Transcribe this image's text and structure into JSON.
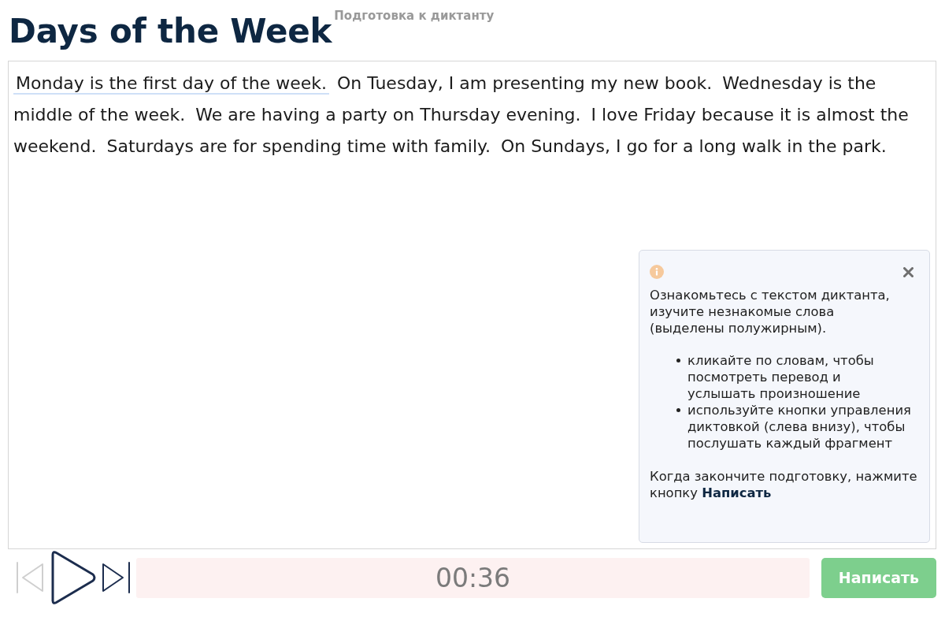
{
  "header": {
    "title": "Days of the Week",
    "subtitle": "Подготовка к диктанту"
  },
  "text": {
    "sentences": [
      {
        "text": "Monday is the first day of the week.",
        "selected": true
      },
      {
        "text": "On Tuesday, I am presenting my new book.",
        "selected": false
      },
      {
        "text": "Wednesday is the middle of the week.",
        "selected": false
      },
      {
        "text": "We are having a party on Thursday evening.",
        "selected": false
      },
      {
        "text": "I love Friday because it is almost the weekend.",
        "selected": false
      },
      {
        "text": "Saturdays are for spending time with family.",
        "selected": false
      },
      {
        "text": "On Sundays, I go for a long walk in the park.",
        "selected": false
      }
    ]
  },
  "hint": {
    "intro": "Ознакомьтесь с текстом диктанта, изучите незнакомые слова (выделены полужирным).",
    "bullets": [
      "кликайте по словам, чтобы посмотреть перевод и услышать произношение",
      "используйте кнопки управления диктовкой (слева внизу), чтобы послушать каждый фрагмент"
    ],
    "outro": "Когда закончите подготовку, нажмите кнопку **Написать**"
  },
  "player": {
    "controls": [
      {
        "kind": "previous",
        "disabled": true
      },
      {
        "kind": "play",
        "disabled": false
      },
      {
        "kind": "next",
        "disabled": false
      }
    ],
    "timer": "00:36"
  },
  "write_button": {
    "label": "Написать"
  }
}
